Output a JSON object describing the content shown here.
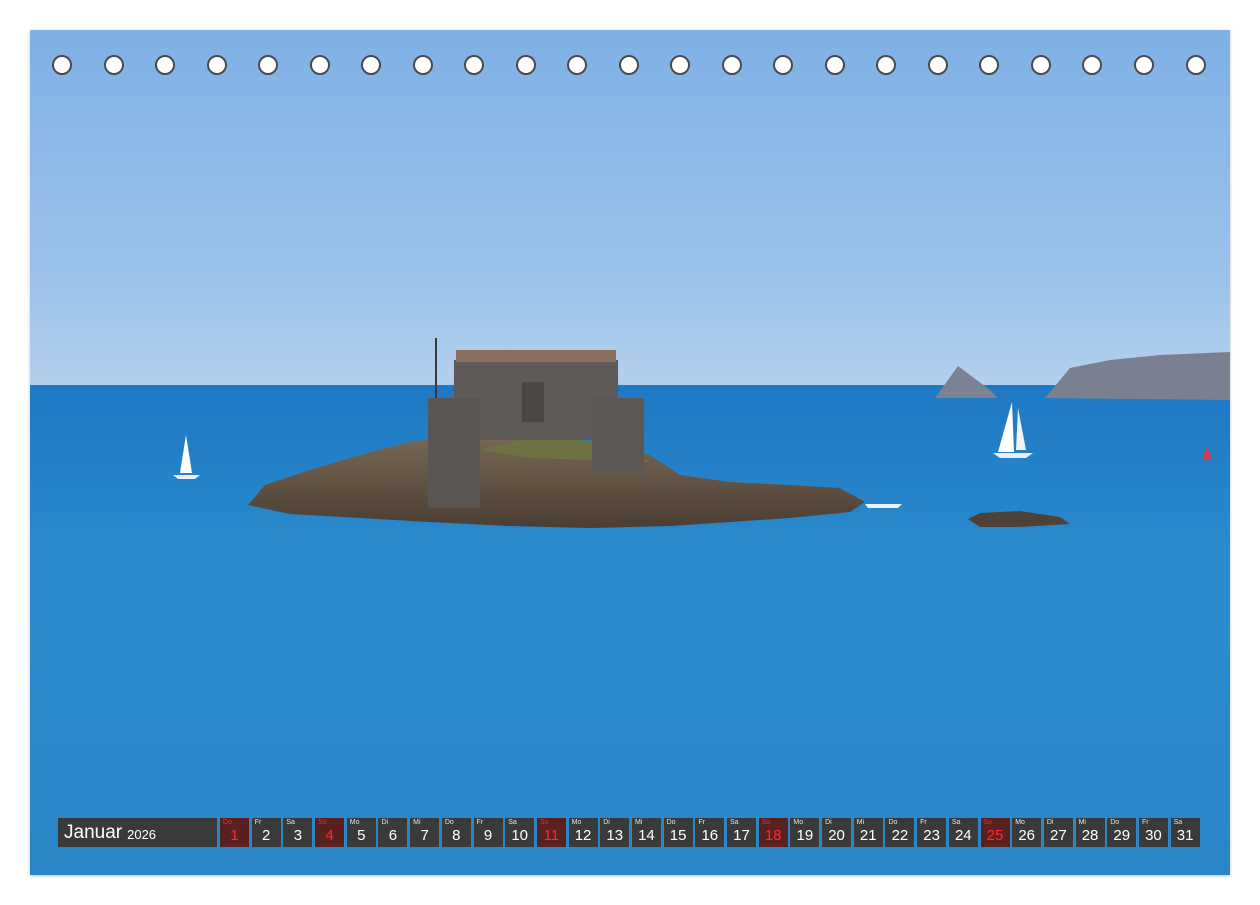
{
  "calendar": {
    "month": "Januar",
    "year": "2026",
    "days": [
      {
        "wd": "Do",
        "num": "1",
        "holiday": true
      },
      {
        "wd": "Fr",
        "num": "2"
      },
      {
        "wd": "Sa",
        "num": "3"
      },
      {
        "wd": "So",
        "num": "4",
        "holiday": true
      },
      {
        "wd": "Mo",
        "num": "5"
      },
      {
        "wd": "Di",
        "num": "6"
      },
      {
        "wd": "Mi",
        "num": "7"
      },
      {
        "wd": "Do",
        "num": "8"
      },
      {
        "wd": "Fr",
        "num": "9"
      },
      {
        "wd": "Sa",
        "num": "10"
      },
      {
        "wd": "So",
        "num": "11",
        "holiday": true
      },
      {
        "wd": "Mo",
        "num": "12"
      },
      {
        "wd": "Di",
        "num": "13"
      },
      {
        "wd": "Mi",
        "num": "14"
      },
      {
        "wd": "Do",
        "num": "15"
      },
      {
        "wd": "Fr",
        "num": "16"
      },
      {
        "wd": "Sa",
        "num": "17"
      },
      {
        "wd": "So",
        "num": "18",
        "holiday": true
      },
      {
        "wd": "Mo",
        "num": "19"
      },
      {
        "wd": "Di",
        "num": "20"
      },
      {
        "wd": "Mi",
        "num": "21"
      },
      {
        "wd": "Do",
        "num": "22"
      },
      {
        "wd": "Fr",
        "num": "23"
      },
      {
        "wd": "Sa",
        "num": "24"
      },
      {
        "wd": "So",
        "num": "25",
        "holiday": true
      },
      {
        "wd": "Mo",
        "num": "26"
      },
      {
        "wd": "Di",
        "num": "27"
      },
      {
        "wd": "Mi",
        "num": "28"
      },
      {
        "wd": "Do",
        "num": "29"
      },
      {
        "wd": "Fr",
        "num": "30"
      },
      {
        "wd": "Sa",
        "num": "31"
      }
    ]
  },
  "colors": {
    "sky": "#8db6e6",
    "sea": "#2a87c8",
    "bar": "#3a3a3a",
    "holiday": "#ff2a2a"
  }
}
